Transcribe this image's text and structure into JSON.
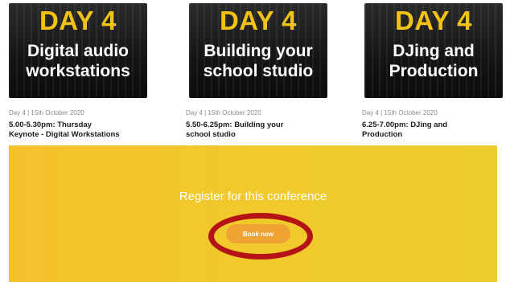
{
  "sessions": [
    {
      "thumb_day": "DAY 4",
      "thumb_line1": "Digital audio",
      "thumb_line2": "workstations",
      "meta": "Day 4 | 15th October 2020",
      "title_line1": "5.00-5.30pm: Thursday",
      "title_line2": "Keynote - Digital Workstations"
    },
    {
      "thumb_day": "DAY 4",
      "thumb_line1": "Building your",
      "thumb_line2": "school studio",
      "meta": "Day 4 | 15th October 2020",
      "title_line1": "5.50-6.25pm: Building your",
      "title_line2": "school studio"
    },
    {
      "thumb_day": "DAY 4",
      "thumb_line1": "DJing and",
      "thumb_line2": "Production",
      "meta": "Day 4 | 15th October 2020",
      "title_line1": "6.25-7.00pm: DJing and",
      "title_line2": "Production"
    }
  ],
  "register": {
    "heading": "Register for this conference",
    "book_label": "Book now"
  },
  "colors": {
    "banner": "#f1c92b",
    "button": "#f0a335",
    "highlight_ring": "#b41318",
    "thumb_day_text": "#f2c316"
  }
}
